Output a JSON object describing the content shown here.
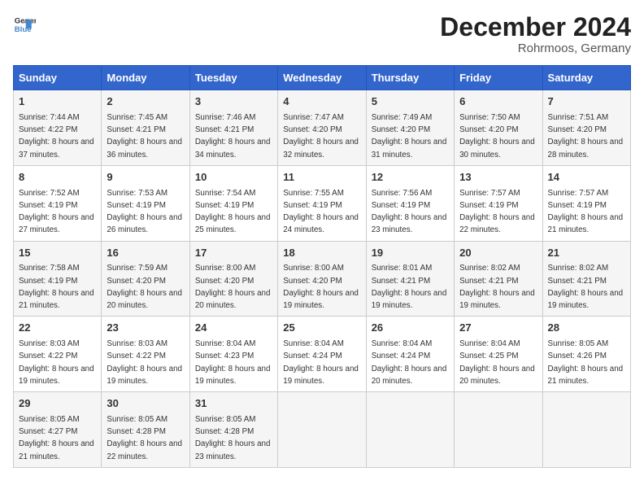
{
  "header": {
    "logo_line1": "General",
    "logo_line2": "Blue",
    "month_title": "December 2024",
    "location": "Rohrmoos, Germany"
  },
  "weekdays": [
    "Sunday",
    "Monday",
    "Tuesday",
    "Wednesday",
    "Thursday",
    "Friday",
    "Saturday"
  ],
  "weeks": [
    [
      {
        "day": "1",
        "rise": "Sunrise: 7:44 AM",
        "set": "Sunset: 4:22 PM",
        "light": "Daylight: 8 hours and 37 minutes."
      },
      {
        "day": "2",
        "rise": "Sunrise: 7:45 AM",
        "set": "Sunset: 4:21 PM",
        "light": "Daylight: 8 hours and 36 minutes."
      },
      {
        "day": "3",
        "rise": "Sunrise: 7:46 AM",
        "set": "Sunset: 4:21 PM",
        "light": "Daylight: 8 hours and 34 minutes."
      },
      {
        "day": "4",
        "rise": "Sunrise: 7:47 AM",
        "set": "Sunset: 4:20 PM",
        "light": "Daylight: 8 hours and 32 minutes."
      },
      {
        "day": "5",
        "rise": "Sunrise: 7:49 AM",
        "set": "Sunset: 4:20 PM",
        "light": "Daylight: 8 hours and 31 minutes."
      },
      {
        "day": "6",
        "rise": "Sunrise: 7:50 AM",
        "set": "Sunset: 4:20 PM",
        "light": "Daylight: 8 hours and 30 minutes."
      },
      {
        "day": "7",
        "rise": "Sunrise: 7:51 AM",
        "set": "Sunset: 4:20 PM",
        "light": "Daylight: 8 hours and 28 minutes."
      }
    ],
    [
      {
        "day": "8",
        "rise": "Sunrise: 7:52 AM",
        "set": "Sunset: 4:19 PM",
        "light": "Daylight: 8 hours and 27 minutes."
      },
      {
        "day": "9",
        "rise": "Sunrise: 7:53 AM",
        "set": "Sunset: 4:19 PM",
        "light": "Daylight: 8 hours and 26 minutes."
      },
      {
        "day": "10",
        "rise": "Sunrise: 7:54 AM",
        "set": "Sunset: 4:19 PM",
        "light": "Daylight: 8 hours and 25 minutes."
      },
      {
        "day": "11",
        "rise": "Sunrise: 7:55 AM",
        "set": "Sunset: 4:19 PM",
        "light": "Daylight: 8 hours and 24 minutes."
      },
      {
        "day": "12",
        "rise": "Sunrise: 7:56 AM",
        "set": "Sunset: 4:19 PM",
        "light": "Daylight: 8 hours and 23 minutes."
      },
      {
        "day": "13",
        "rise": "Sunrise: 7:57 AM",
        "set": "Sunset: 4:19 PM",
        "light": "Daylight: 8 hours and 22 minutes."
      },
      {
        "day": "14",
        "rise": "Sunrise: 7:57 AM",
        "set": "Sunset: 4:19 PM",
        "light": "Daylight: 8 hours and 21 minutes."
      }
    ],
    [
      {
        "day": "15",
        "rise": "Sunrise: 7:58 AM",
        "set": "Sunset: 4:19 PM",
        "light": "Daylight: 8 hours and 21 minutes."
      },
      {
        "day": "16",
        "rise": "Sunrise: 7:59 AM",
        "set": "Sunset: 4:20 PM",
        "light": "Daylight: 8 hours and 20 minutes."
      },
      {
        "day": "17",
        "rise": "Sunrise: 8:00 AM",
        "set": "Sunset: 4:20 PM",
        "light": "Daylight: 8 hours and 20 minutes."
      },
      {
        "day": "18",
        "rise": "Sunrise: 8:00 AM",
        "set": "Sunset: 4:20 PM",
        "light": "Daylight: 8 hours and 19 minutes."
      },
      {
        "day": "19",
        "rise": "Sunrise: 8:01 AM",
        "set": "Sunset: 4:21 PM",
        "light": "Daylight: 8 hours and 19 minutes."
      },
      {
        "day": "20",
        "rise": "Sunrise: 8:02 AM",
        "set": "Sunset: 4:21 PM",
        "light": "Daylight: 8 hours and 19 minutes."
      },
      {
        "day": "21",
        "rise": "Sunrise: 8:02 AM",
        "set": "Sunset: 4:21 PM",
        "light": "Daylight: 8 hours and 19 minutes."
      }
    ],
    [
      {
        "day": "22",
        "rise": "Sunrise: 8:03 AM",
        "set": "Sunset: 4:22 PM",
        "light": "Daylight: 8 hours and 19 minutes."
      },
      {
        "day": "23",
        "rise": "Sunrise: 8:03 AM",
        "set": "Sunset: 4:22 PM",
        "light": "Daylight: 8 hours and 19 minutes."
      },
      {
        "day": "24",
        "rise": "Sunrise: 8:04 AM",
        "set": "Sunset: 4:23 PM",
        "light": "Daylight: 8 hours and 19 minutes."
      },
      {
        "day": "25",
        "rise": "Sunrise: 8:04 AM",
        "set": "Sunset: 4:24 PM",
        "light": "Daylight: 8 hours and 19 minutes."
      },
      {
        "day": "26",
        "rise": "Sunrise: 8:04 AM",
        "set": "Sunset: 4:24 PM",
        "light": "Daylight: 8 hours and 20 minutes."
      },
      {
        "day": "27",
        "rise": "Sunrise: 8:04 AM",
        "set": "Sunset: 4:25 PM",
        "light": "Daylight: 8 hours and 20 minutes."
      },
      {
        "day": "28",
        "rise": "Sunrise: 8:05 AM",
        "set": "Sunset: 4:26 PM",
        "light": "Daylight: 8 hours and 21 minutes."
      }
    ],
    [
      {
        "day": "29",
        "rise": "Sunrise: 8:05 AM",
        "set": "Sunset: 4:27 PM",
        "light": "Daylight: 8 hours and 21 minutes."
      },
      {
        "day": "30",
        "rise": "Sunrise: 8:05 AM",
        "set": "Sunset: 4:28 PM",
        "light": "Daylight: 8 hours and 22 minutes."
      },
      {
        "day": "31",
        "rise": "Sunrise: 8:05 AM",
        "set": "Sunset: 4:28 PM",
        "light": "Daylight: 8 hours and 23 minutes."
      },
      null,
      null,
      null,
      null
    ]
  ]
}
